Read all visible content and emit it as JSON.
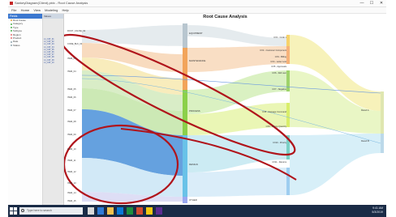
{
  "window": {
    "title": "SankeyDiagram(Client).pbix - Root Cause Analysis",
    "controls": [
      "—",
      "☐",
      "✕"
    ]
  },
  "menubar": [
    "File",
    "Home",
    "View",
    "Modeling",
    "Help"
  ],
  "left_panel": {
    "header": "Fields",
    "rows": [
      "Root Cause",
      "Category",
      "Type",
      "Subtype",
      "Region",
      "Product",
      "Date",
      "Status"
    ]
  },
  "mid_panel": {
    "header": "Values",
    "rows": [
      "L1_CAT_01",
      "L1_CAT_02",
      "L1_CAT_03",
      "L1_CAT_04",
      "L1_CAT_05",
      "L1_CAT_06",
      "L1_CAT_07",
      "L1_CAT_08",
      "L1_CAT_09",
      "L1_CAT_10"
    ]
  },
  "chart": {
    "title": "Root Cause Analysis",
    "left_labels": [
      "ROOT_CAUSE_01",
      "CODE_BLK_02",
      "ITEM_03",
      "ITEM_04",
      "ITEM_05",
      "ITEM_06",
      "ITEM_07",
      "ITEM_08",
      "ITEM_09",
      "ITEM_10",
      "ITEM_11",
      "ITEM_12",
      "ITEM_13",
      "ITEM_14",
      "ITEM_15"
    ],
    "middle_labels": [
      "EQUIPMENT",
      "MAINTENANCE",
      "PROCESS",
      "DESIGN",
      "OTHER"
    ],
    "right_labels": [
      "CX1 - Code 1",
      "CX2 - Customer Component",
      "CX3 - Billing",
      "CX4 - Letter Lost",
      "CX5 - Approvals",
      "CX6 - Roll over",
      "CX7 - Negative",
      "CX8 - Damage Command",
      "CX9 - Wrong Quantity",
      "CX10 - Priority",
      "CX11 - Returns"
    ],
    "far_right_labels": [
      "Result A",
      "Result B"
    ]
  },
  "taskbar": {
    "search_placeholder": "Type here to search",
    "time": "9:41 AM",
    "date": "5/3/2019"
  }
}
